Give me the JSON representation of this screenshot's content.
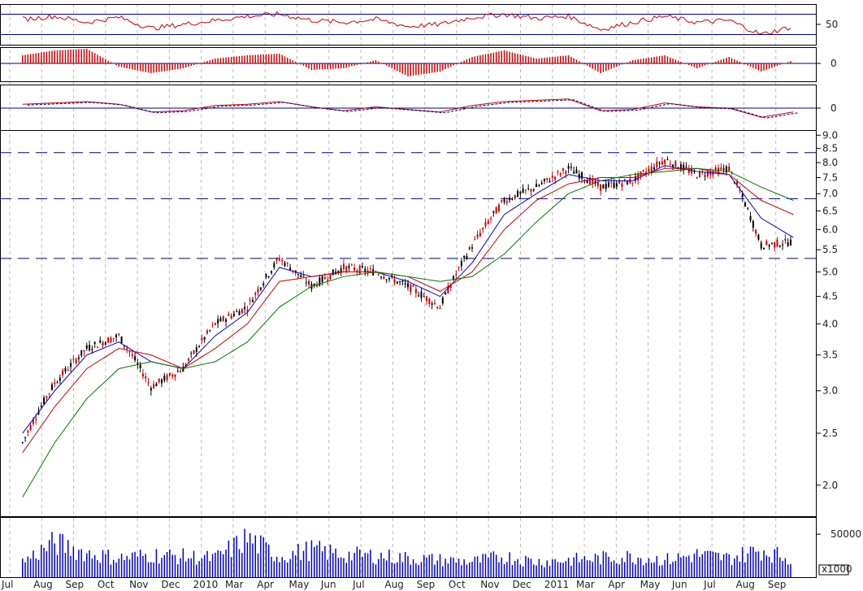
{
  "chart_data": {
    "type": "line",
    "title": "",
    "ylim": [
      1.75,
      9.2
    ],
    "y_scale": "log",
    "x": [
      "Jul 2009",
      "Aug",
      "Sep",
      "Oct",
      "Nov",
      "Dec",
      "2010",
      "Mar",
      "Apr",
      "May",
      "Jun",
      "Jul",
      "Aug",
      "Sep",
      "Oct",
      "Nov",
      "Dec",
      "2011",
      "Mar",
      "Apr",
      "May",
      "Jun",
      "Jul",
      "Aug",
      "Sep"
    ],
    "x_tick_labels": [
      "Jul",
      "Aug",
      "Sep",
      "Oct",
      "Nov",
      "Dec",
      "2010",
      "Mar",
      "Apr",
      "May",
      "Jun",
      "Jul",
      "Aug",
      "Sep",
      "Oct",
      "Nov",
      "Dec",
      "2011",
      "Mar",
      "Apr",
      "May",
      "Jun",
      "Jul",
      "Aug",
      "Sep"
    ],
    "y_tick_labels": [
      "2.0",
      "2.5",
      "3.0",
      "3.5",
      "4.0",
      "4.5",
      "5.0",
      "5.5",
      "6.0",
      "6.5",
      "7.0",
      "7.5",
      "8.0",
      "8.5",
      "9.0"
    ],
    "y_ticks": [
      2.0,
      2.5,
      3.0,
      3.5,
      4.0,
      4.5,
      5.0,
      5.5,
      6.0,
      6.5,
      7.0,
      7.5,
      8.0,
      8.5,
      9.0
    ],
    "horizontal_lines": [
      8.35,
      6.85,
      5.3
    ],
    "series": [
      {
        "role": "price",
        "color": "#000000",
        "values": [
          2.4,
          3.1,
          3.6,
          3.8,
          3.05,
          3.3,
          4.0,
          4.3,
          5.3,
          4.7,
          5.1,
          5.0,
          4.7,
          4.3,
          5.6,
          6.8,
          7.2,
          7.8,
          7.2,
          7.4,
          8.1,
          7.6,
          7.8,
          5.6,
          5.7
        ]
      },
      {
        "role": "ma-short",
        "color": "#0000cc",
        "values": [
          2.5,
          3.0,
          3.5,
          3.7,
          3.4,
          3.3,
          3.8,
          4.2,
          5.1,
          4.9,
          5.0,
          5.0,
          4.8,
          4.5,
          5.2,
          6.4,
          7.0,
          7.6,
          7.4,
          7.4,
          7.9,
          7.7,
          7.6,
          6.3,
          5.8
        ]
      },
      {
        "role": "ma-mid",
        "color": "#cc0000",
        "values": [
          2.3,
          2.8,
          3.3,
          3.6,
          3.5,
          3.3,
          3.6,
          4.0,
          4.8,
          4.9,
          5.0,
          5.0,
          4.9,
          4.6,
          5.0,
          6.0,
          6.8,
          7.3,
          7.5,
          7.5,
          7.8,
          7.8,
          7.6,
          6.8,
          6.4
        ]
      },
      {
        "role": "ma-long",
        "color": "#007700",
        "values": [
          1.9,
          2.4,
          2.9,
          3.3,
          3.4,
          3.3,
          3.4,
          3.7,
          4.3,
          4.7,
          4.9,
          5.0,
          4.9,
          4.8,
          4.9,
          5.4,
          6.2,
          7.0,
          7.4,
          7.6,
          7.7,
          7.8,
          7.7,
          7.2,
          6.8
        ]
      }
    ],
    "indicator_upper": {
      "y_tick_label": "50",
      "values": [
        55,
        58,
        52,
        57,
        46,
        50,
        54,
        58,
        60,
        54,
        52,
        55,
        48,
        50,
        57,
        60,
        56,
        58,
        45,
        52,
        58,
        52,
        54,
        40,
        48
      ]
    },
    "indicator_histogram": {
      "y_tick_label": "0",
      "values": [
        0.5,
        0.8,
        0.9,
        -0.2,
        -0.6,
        -0.3,
        0.3,
        0.5,
        0.6,
        -0.4,
        -0.3,
        0.2,
        -0.8,
        -0.5,
        0.4,
        0.8,
        0.3,
        0.5,
        -0.6,
        0.2,
        0.5,
        -0.3,
        0.4,
        -0.5,
        0.2
      ]
    },
    "indicator_macd": {
      "y_tick_label": "0",
      "values": [
        0.3,
        0.4,
        0.5,
        0.3,
        -0.3,
        -0.2,
        0.2,
        0.3,
        0.5,
        0.1,
        -0.2,
        0.1,
        -0.1,
        -0.3,
        0.2,
        0.5,
        0.6,
        0.7,
        -0.2,
        -0.1,
        0.4,
        0.1,
        0.0,
        -0.7,
        -0.3
      ]
    },
    "volume": {
      "y_tick_label": "50000",
      "unit_label": "x1000",
      "values": [
        18,
        40,
        28,
        22,
        26,
        24,
        22,
        45,
        24,
        32,
        26,
        25,
        22,
        20,
        18,
        24,
        18,
        20,
        22,
        24,
        20,
        26,
        22,
        32,
        20
      ]
    }
  }
}
